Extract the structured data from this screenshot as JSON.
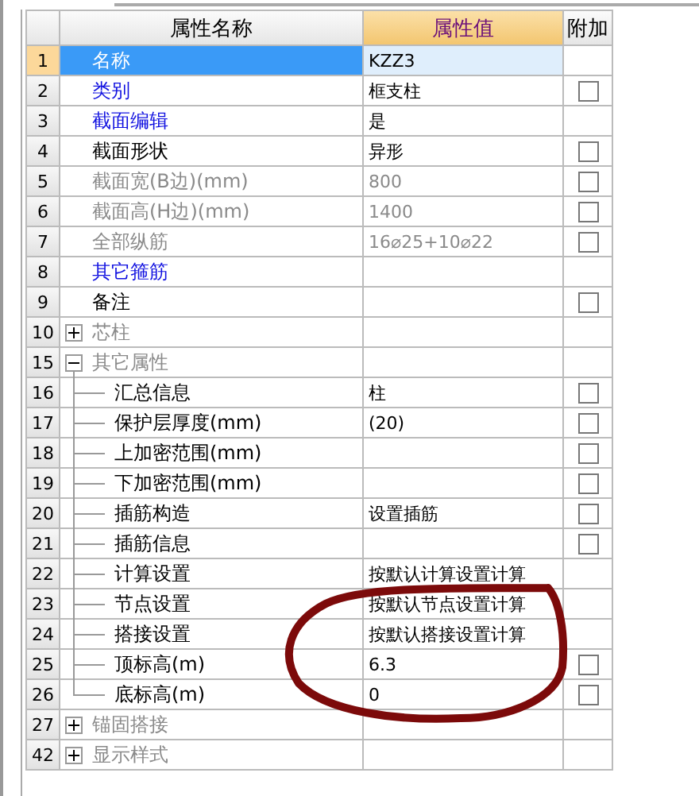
{
  "columns": [
    "属性名称",
    "属性值",
    "附加"
  ],
  "rows": [
    {
      "number": "1",
      "name": "名称",
      "kind": "plain",
      "value": "KZZ3",
      "selected": true
    },
    {
      "number": "2",
      "name": "类别",
      "kind": "link",
      "value": "框支柱",
      "checked": false,
      "selected": false
    },
    {
      "number": "3",
      "name": "截面编辑",
      "kind": "link",
      "value": "是",
      "selected": false
    },
    {
      "number": "4",
      "name": "截面形状",
      "kind": "plain",
      "value": "异形",
      "checked": false,
      "selected": false
    },
    {
      "number": "5",
      "name": "截面宽(B边)(mm)",
      "kind": "disabled",
      "value": "800",
      "checked": false,
      "selected": false
    },
    {
      "number": "6",
      "name": "截面高(H边)(mm)",
      "kind": "disabled",
      "value": "1400",
      "checked": false,
      "selected": false
    },
    {
      "number": "7",
      "name": "全部纵筋",
      "kind": "disabled",
      "value": "16⌀25+10⌀22",
      "checked": false,
      "selected": false
    },
    {
      "number": "8",
      "name": "其它箍筋",
      "kind": "link",
      "selected": false
    },
    {
      "number": "9",
      "name": "备注",
      "kind": "plain",
      "checked": false,
      "selected": false
    },
    {
      "number": "10",
      "name": "芯柱",
      "kind": "group",
      "expanded": false,
      "selected": false
    },
    {
      "number": "15",
      "name": "其它属性",
      "kind": "group",
      "expanded": true,
      "selected": false,
      "children": [
        {
          "number": "16",
          "name": "汇总信息",
          "kind": "plain",
          "value": "柱",
          "checked": false,
          "selected": false
        },
        {
          "number": "17",
          "name": "保护层厚度(mm)",
          "kind": "plain",
          "value": "(20)",
          "checked": false,
          "selected": false
        },
        {
          "number": "18",
          "name": "上加密范围(mm)",
          "kind": "plain",
          "checked": false,
          "selected": false
        },
        {
          "number": "19",
          "name": "下加密范围(mm)",
          "kind": "plain",
          "checked": false,
          "selected": false
        },
        {
          "number": "20",
          "name": "插筋构造",
          "kind": "plain",
          "value": "设置插筋",
          "checked": false,
          "selected": false
        },
        {
          "number": "21",
          "name": "插筋信息",
          "kind": "plain",
          "checked": false,
          "selected": false
        },
        {
          "number": "22",
          "name": "计算设置",
          "kind": "plain",
          "value": "按默认计算设置计算",
          "selected": false
        },
        {
          "number": "23",
          "name": "节点设置",
          "kind": "plain",
          "value": "按默认节点设置计算",
          "selected": false
        },
        {
          "number": "24",
          "name": "搭接设置",
          "kind": "plain",
          "value": "按默认搭接设置计算",
          "selected": false
        },
        {
          "number": "25",
          "name": "顶标高(m)",
          "kind": "plain",
          "value": "6.3",
          "checked": false,
          "selected": false
        },
        {
          "number": "26",
          "name": "底标高(m)",
          "kind": "plain",
          "value": "0",
          "checked": false,
          "selected": false
        }
      ]
    },
    {
      "number": "27",
      "name": "锚固搭接",
      "kind": "group",
      "expanded": false,
      "selected": false
    },
    {
      "number": "42",
      "name": "显示样式",
      "kind": "group",
      "expanded": false,
      "selected": false
    }
  ],
  "annotation": {
    "kind": "ellipse"
  }
}
